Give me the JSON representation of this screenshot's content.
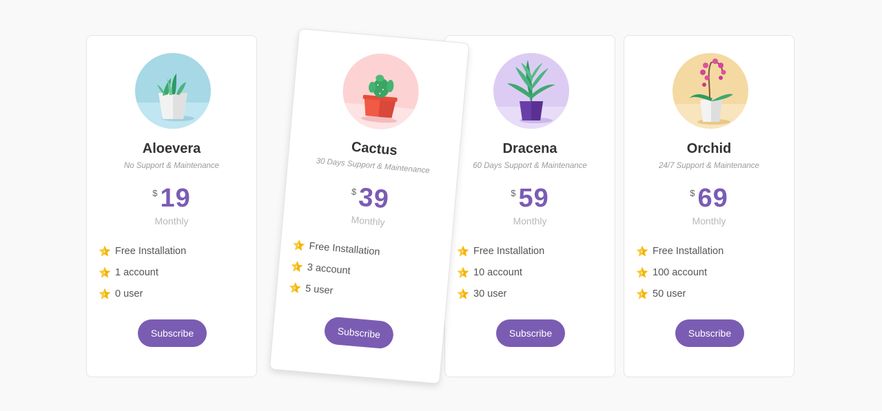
{
  "colors": {
    "accent": "#7b5cb3",
    "star": "#f5b400",
    "card_bg": "#ffffff",
    "page_bg": "#f9f9f9"
  },
  "plans": [
    {
      "name": "Aloevera",
      "support": "No Support & Maintenance",
      "currency": "$",
      "price": "19",
      "period": "Monthly",
      "features": [
        "Free Installation",
        "1 account",
        "0 user"
      ],
      "button": "Subscribe",
      "illustration": "aloe-plant-icon",
      "bg_color": "#a7d8e6"
    },
    {
      "name": "Cactus",
      "support": "30 Days Support & Maintenance",
      "currency": "$",
      "price": "39",
      "period": "Monthly",
      "features": [
        "Free Installation",
        "3 account",
        "5 user"
      ],
      "button": "Subscribe",
      "illustration": "cactus-plant-icon",
      "bg_color": "#fdd2d2"
    },
    {
      "name": "Dracena",
      "support": "60 Days Support & Maintenance",
      "currency": "$",
      "price": "59",
      "period": "Monthly",
      "features": [
        "Free Installation",
        "10 account",
        "30 user"
      ],
      "button": "Subscribe",
      "illustration": "dracena-plant-icon",
      "bg_color": "#dcccf3"
    },
    {
      "name": "Orchid",
      "support": "24/7 Support & Maintenance",
      "currency": "$",
      "price": "69",
      "period": "Monthly",
      "features": [
        "Free Installation",
        "100 account",
        "50 user"
      ],
      "button": "Subscribe",
      "illustration": "orchid-plant-icon",
      "bg_color": "#f5d9a2"
    }
  ]
}
